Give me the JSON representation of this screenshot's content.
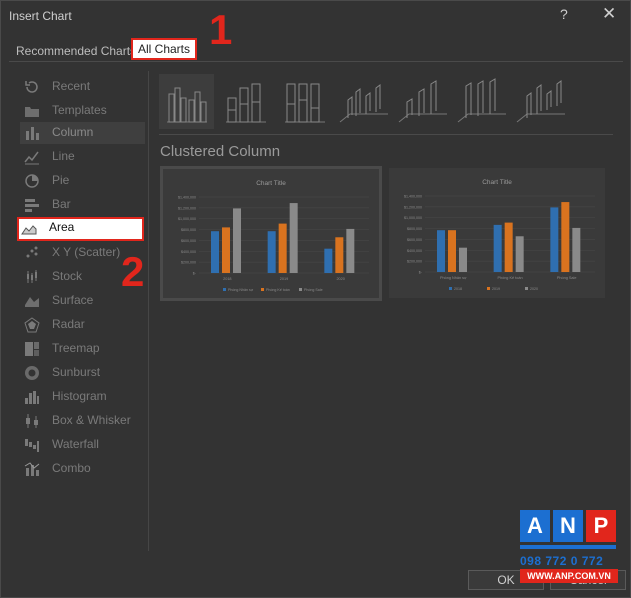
{
  "dialog": {
    "title": "Insert Chart",
    "help": "?",
    "close": "✕"
  },
  "tabs": {
    "recommended": "Recommended Charts",
    "all": "All Charts"
  },
  "steps": {
    "one": "1",
    "two": "2"
  },
  "sidebar": {
    "items": [
      {
        "label": "Recent",
        "icon": "recent-icon"
      },
      {
        "label": "Templates",
        "icon": "templates-icon"
      },
      {
        "label": "Column",
        "icon": "column-chart-icon"
      },
      {
        "label": "Line",
        "icon": "line-chart-icon"
      },
      {
        "label": "Pie",
        "icon": "pie-chart-icon"
      },
      {
        "label": "Bar",
        "icon": "bar-chart-icon"
      },
      {
        "label": "Area",
        "icon": "area-chart-icon"
      },
      {
        "label": "X Y (Scatter)",
        "icon": "scatter-chart-icon"
      },
      {
        "label": "Stock",
        "icon": "stock-chart-icon"
      },
      {
        "label": "Surface",
        "icon": "surface-chart-icon"
      },
      {
        "label": "Radar",
        "icon": "radar-chart-icon"
      },
      {
        "label": "Treemap",
        "icon": "treemap-chart-icon"
      },
      {
        "label": "Sunburst",
        "icon": "sunburst-chart-icon"
      },
      {
        "label": "Histogram",
        "icon": "histogram-chart-icon"
      },
      {
        "label": "Box & Whisker",
        "icon": "box-whisker-chart-icon"
      },
      {
        "label": "Waterfall",
        "icon": "waterfall-chart-icon"
      },
      {
        "label": "Combo",
        "icon": "combo-chart-icon"
      }
    ]
  },
  "subtype": {
    "title": "Clustered Column"
  },
  "preview1": {
    "chart_title": "Chart Title",
    "yticks": [
      "$1,400,000",
      "$1,200,000",
      "$1,000,000",
      "$800,000",
      "$600,000",
      "$400,000",
      "$200,000",
      "$-"
    ],
    "categories": [
      "2018",
      "2019",
      "2020"
    ],
    "legend": [
      "Phòng Nhân sự",
      "Phòng Kế toán",
      "Phòng Sale"
    ]
  },
  "preview2": {
    "chart_title": "Chart Title",
    "yticks": [
      "$1,400,000",
      "$1,200,000",
      "$1,000,000",
      "$800,000",
      "$600,000",
      "$400,000",
      "$200,000",
      "$-"
    ],
    "categories": [
      "Phòng Nhân sự",
      "Phòng Kế toán",
      "Phòng Sale"
    ],
    "legend": [
      "2018",
      "2019",
      "2020"
    ]
  },
  "colors": {
    "blue": "#2f6fb0",
    "orange": "#d9731f",
    "gray": "#8a8a8a",
    "red": "#e1261c"
  },
  "buttons": {
    "ok": "OK",
    "cancel": "Cancel"
  },
  "logo": {
    "a": "A",
    "n": "N",
    "p": "P",
    "phone": "098 772 0 772",
    "web": "WWW.ANP.COM.VN"
  }
}
